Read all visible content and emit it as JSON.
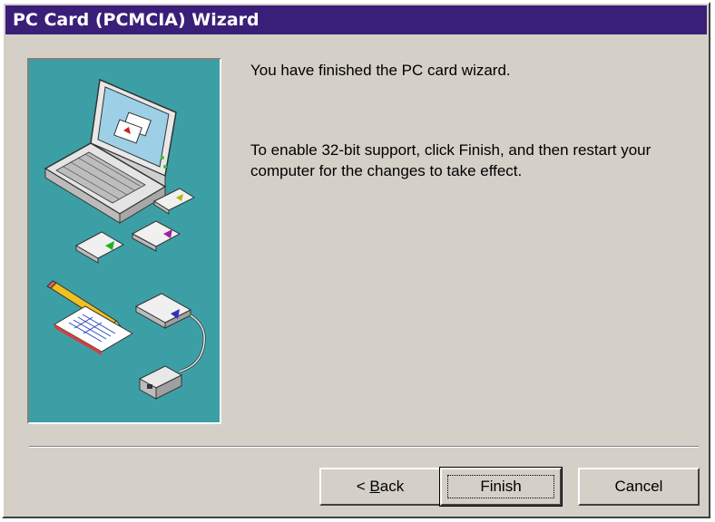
{
  "window": {
    "title": "PC Card (PCMCIA) Wizard"
  },
  "message": {
    "line1": "You have finished the PC card wizard.",
    "line2": "To enable 32-bit support, click Finish, and then restart your computer for the changes to take effect."
  },
  "buttons": {
    "back_prefix": "< ",
    "back_mnemonic": "B",
    "back_rest": "ack",
    "finish": "Finish",
    "cancel": "Cancel"
  },
  "colors": {
    "titlebar": "#3a1f79",
    "illustration_bg": "#3d9fa6",
    "dialog_bg": "#d4d0c8"
  },
  "illustration": {
    "icons": [
      "laptop-icon",
      "pc-card-icon",
      "pencil-icon",
      "document-icon",
      "network-adapter-icon"
    ]
  }
}
